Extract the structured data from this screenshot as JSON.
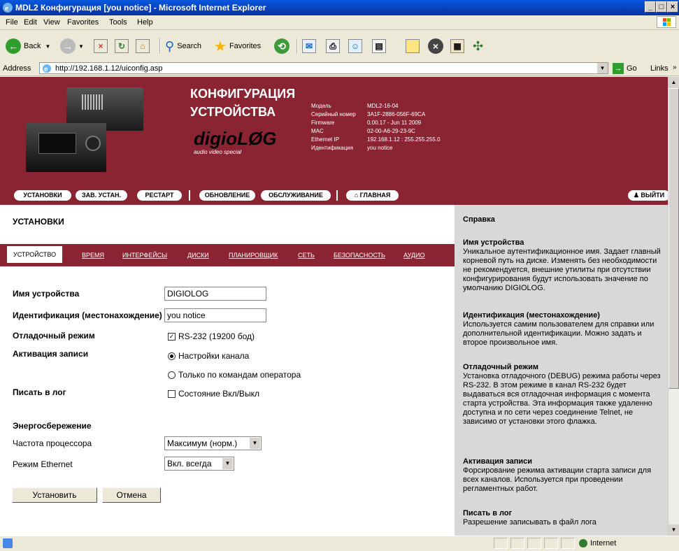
{
  "window": {
    "title": "MDL2 Конфигурация [you notice] - Microsoft Internet Explorer",
    "min": "_",
    "max": "□",
    "close": "×"
  },
  "menu": [
    "File",
    "Edit",
    "View",
    "Favorites",
    "Tools",
    "Help"
  ],
  "toolbar": {
    "back": "Back",
    "search": "Search",
    "favorites": "Favorites"
  },
  "address": {
    "label": "Address",
    "url": "http://192.168.1.12/uiconfig.asp",
    "go": "Go",
    "links": "Links"
  },
  "banner": {
    "title_line1": "КОНФИГУРАЦИЯ",
    "title_line2": "УСТРОЙСТВА",
    "logo": "digioLØG",
    "logo_sub": "audio video special",
    "info": [
      {
        "key": "Модель",
        "value": "MDL2-16-04"
      },
      {
        "key": "Серийный номер",
        "value": "3A1F-2886-056F-69CA"
      },
      {
        "key": "Firmware",
        "value": "0.00.17 - Jun 11 2009"
      },
      {
        "key": "MAC",
        "value": "02-00-A6-29-23-9C"
      },
      {
        "key": "Ethernet IP",
        "value": "192.168.1.12 : 255.255.255.0"
      },
      {
        "key": "Идентификация",
        "value": "you notice"
      }
    ]
  },
  "nav": {
    "settings": "УСТАНОВКИ",
    "factory": "ЗАВ. УСТАН.",
    "restart": "РЕСТАРТ",
    "update": "ОБНОВЛЕНИЕ",
    "service": "ОБСЛУЖИВАНИЕ",
    "home": "ГЛАВНАЯ",
    "logout": "ВЫЙТИ"
  },
  "main": {
    "heading": "УСТАНОВКИ",
    "tabs": [
      "УСТРОЙСТВО",
      "ВРЕМЯ",
      "ИНТЕРФЕЙСЫ",
      "ДИСКИ",
      "ПЛАНИРОВЩИК",
      "СЕТЬ",
      "БЕЗОПАСНОСТЬ",
      "АУДИО"
    ],
    "fields": {
      "device_name_label": "Имя устройства",
      "device_name_value": "DIGIOLOG",
      "ident_label": "Идентификация (местонахождение)",
      "ident_value": "you notice",
      "debug_label": "Отладочный режим",
      "debug_option": "RS-232 (19200 бод)",
      "rec_label": "Активация записи",
      "rec_option1": "Настройки канала",
      "rec_option2": "Только по командам оператора",
      "log_label": "Писать в лог",
      "log_option": "Состояние Вкл/Выкл",
      "power_label": "Энергосбережение",
      "cpu_label": "Частота процессора",
      "cpu_value": "Максимум (норм.)",
      "eth_label": "Режим Ethernet",
      "eth_value": "Вкл. всегда"
    },
    "apply": "Установить",
    "cancel": "Отмена"
  },
  "help": {
    "title": "Справка",
    "sections": [
      {
        "title": "Имя устройства",
        "text": "Уникальное аутентификационное имя. Задает главный корневой путь на диске. Изменять без необходимости не рекомендуется, внешние утилиты при отсутствии конфигурирования будут использовать значение по умолчанию DIGIOLOG."
      },
      {
        "title": "Идентификация (местонахождение)",
        "text": "Используется самим пользователем для справки или дополнительной идентификации. Можно задать и второе произвольное имя."
      },
      {
        "title": "Отладочный режим",
        "text": "Установка отладочного (DEBUG) режима работы через RS-232. В этом режиме в канал RS-232 будет выдаваться вся отладочная информация с момента старта устройства. Эта информация также удаленно доступна и по сети через соединение Telnet, не зависимо от установки этого флажка."
      },
      {
        "title": "Активация записи",
        "text": "Форсирование режима активации старта записи для всех каналов. Используется при проведении регламентных работ."
      },
      {
        "title": "Писать в лог",
        "text": "Разрешение записывать в файл лога"
      }
    ]
  },
  "status": {
    "zone": "Internet"
  }
}
